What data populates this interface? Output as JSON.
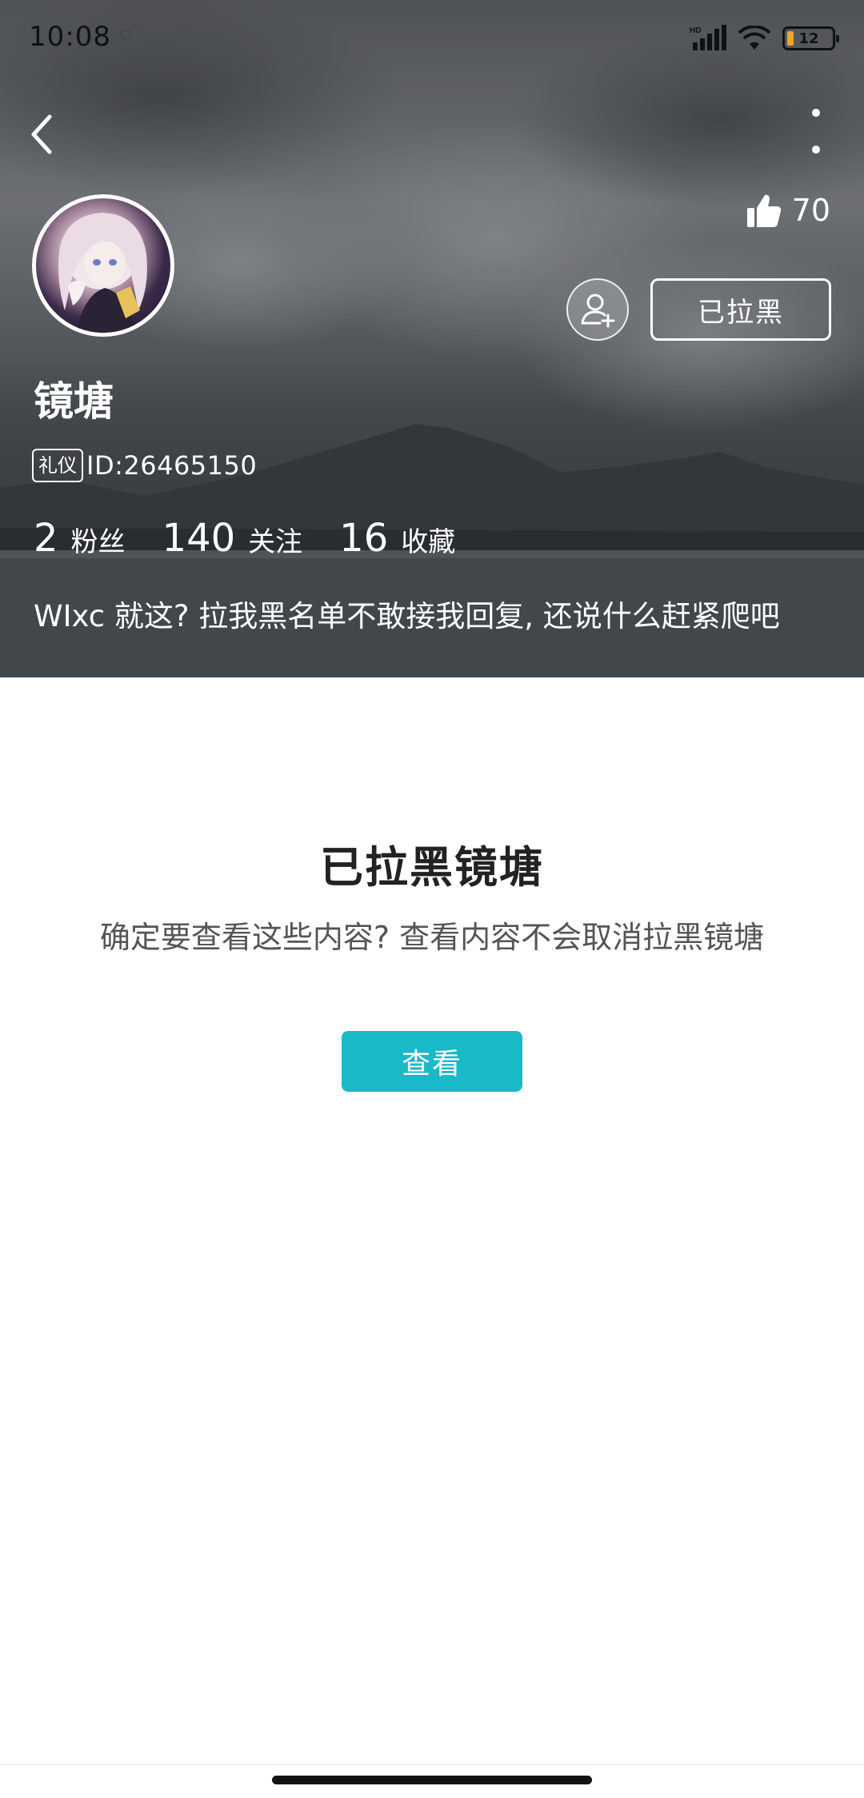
{
  "status_bar": {
    "time": "10:08",
    "network_label": "HD",
    "battery_level": "12",
    "icons": [
      "chat-notification-icon",
      "signal-icon",
      "wifi-icon",
      "battery-icon"
    ]
  },
  "nav": {
    "back_icon": "chevron-left-icon",
    "more_icon": "more-vertical-icon"
  },
  "profile": {
    "username": "镜塘",
    "badge": "礼仪",
    "id_text": "ID:26465150",
    "likes": "70",
    "follow_icon": "add-user-icon",
    "blocked_label": "已拉黑",
    "stats": [
      {
        "value": "2",
        "label": "粉丝"
      },
      {
        "value": "140",
        "label": "关注"
      },
      {
        "value": "16",
        "label": "收藏"
      }
    ],
    "bio": "WIxc 就这? 拉我黑名单不敢接我回复, 还说什么赶紧爬吧"
  },
  "notice": {
    "title": "已拉黑镜塘",
    "description": "确定要查看这些内容? 查看内容不会取消拉黑镜塘",
    "view_button": "查看"
  },
  "colors": {
    "accent": "#1ab9c8",
    "title_text": "#222222",
    "desc_text": "#555555"
  }
}
